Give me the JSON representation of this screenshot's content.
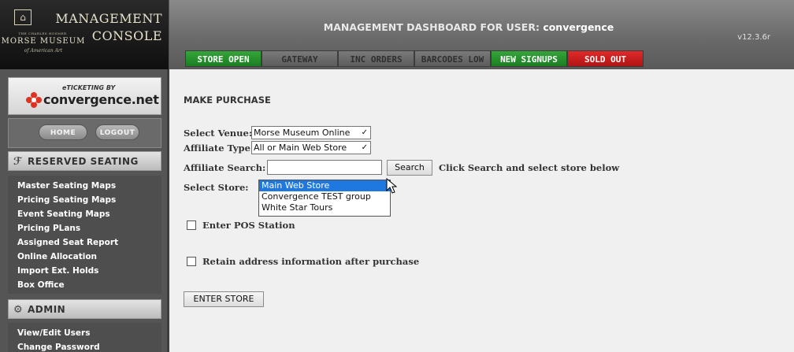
{
  "logo": {
    "management": "MANAGEMENT",
    "console": "CONSOLE",
    "charles": "THE CHARLES HOSMER",
    "morse": "MORSE MUSEUM",
    "american": "of American Art"
  },
  "header": {
    "title_prefix": "MANAGEMENT DASHBOARD FOR USER:",
    "user": "convergence",
    "version": "v12.3.6r",
    "tabs": [
      {
        "label": "STORE OPEN",
        "style": "green"
      },
      {
        "label": "GATEWAY",
        "style": "dim"
      },
      {
        "label": "INC ORDERS",
        "style": "dim"
      },
      {
        "label": "BARCODES LOW",
        "style": "dim"
      },
      {
        "label": "NEW SIGNUPS",
        "style": "green"
      },
      {
        "label": "SOLD OUT",
        "style": "red"
      }
    ]
  },
  "sidebar": {
    "brand_ticketing": "eTICKETING BY",
    "brand_name": "convergence.net",
    "home_label": "HOME",
    "logout_label": "LOGOUT",
    "reserved_title": "RESERVED SEATING",
    "reserved_items": [
      "Master Seating Maps",
      "Pricing Seating Maps",
      "Event Seating Maps",
      "Pricing PLans",
      "Assigned Seat Report",
      "Online Allocation",
      "Import Ext. Holds",
      "Box Office"
    ],
    "admin_title": "ADMIN",
    "admin_items": [
      "View/Edit Users",
      "Change Password"
    ]
  },
  "main": {
    "page_title": "MAKE PURCHASE",
    "venue_label": "Select Venue:",
    "venue_value": "Morse Museum Online",
    "affiliate_type_label": "Affiliate Type:",
    "affiliate_type_value": "All or Main Web Store",
    "affiliate_search_label": "Affiliate Search:",
    "affiliate_search_value": "",
    "search_button": "Search",
    "search_hint": "Click Search and select store below",
    "select_store_label": "Select Store:",
    "stores": [
      "Main Web Store",
      "Convergence TEST group",
      "White Star Tours"
    ],
    "selected_store": "Main Web Store",
    "pos_label": "Enter POS Station",
    "retain_label": "Retain address information after purchase",
    "enter_store_button": "ENTER STORE"
  },
  "colors": {
    "tab_green": "#1b7d22",
    "tab_red": "#b01414",
    "selection": "#1e78e0",
    "sidebar_bg": "#555555"
  }
}
